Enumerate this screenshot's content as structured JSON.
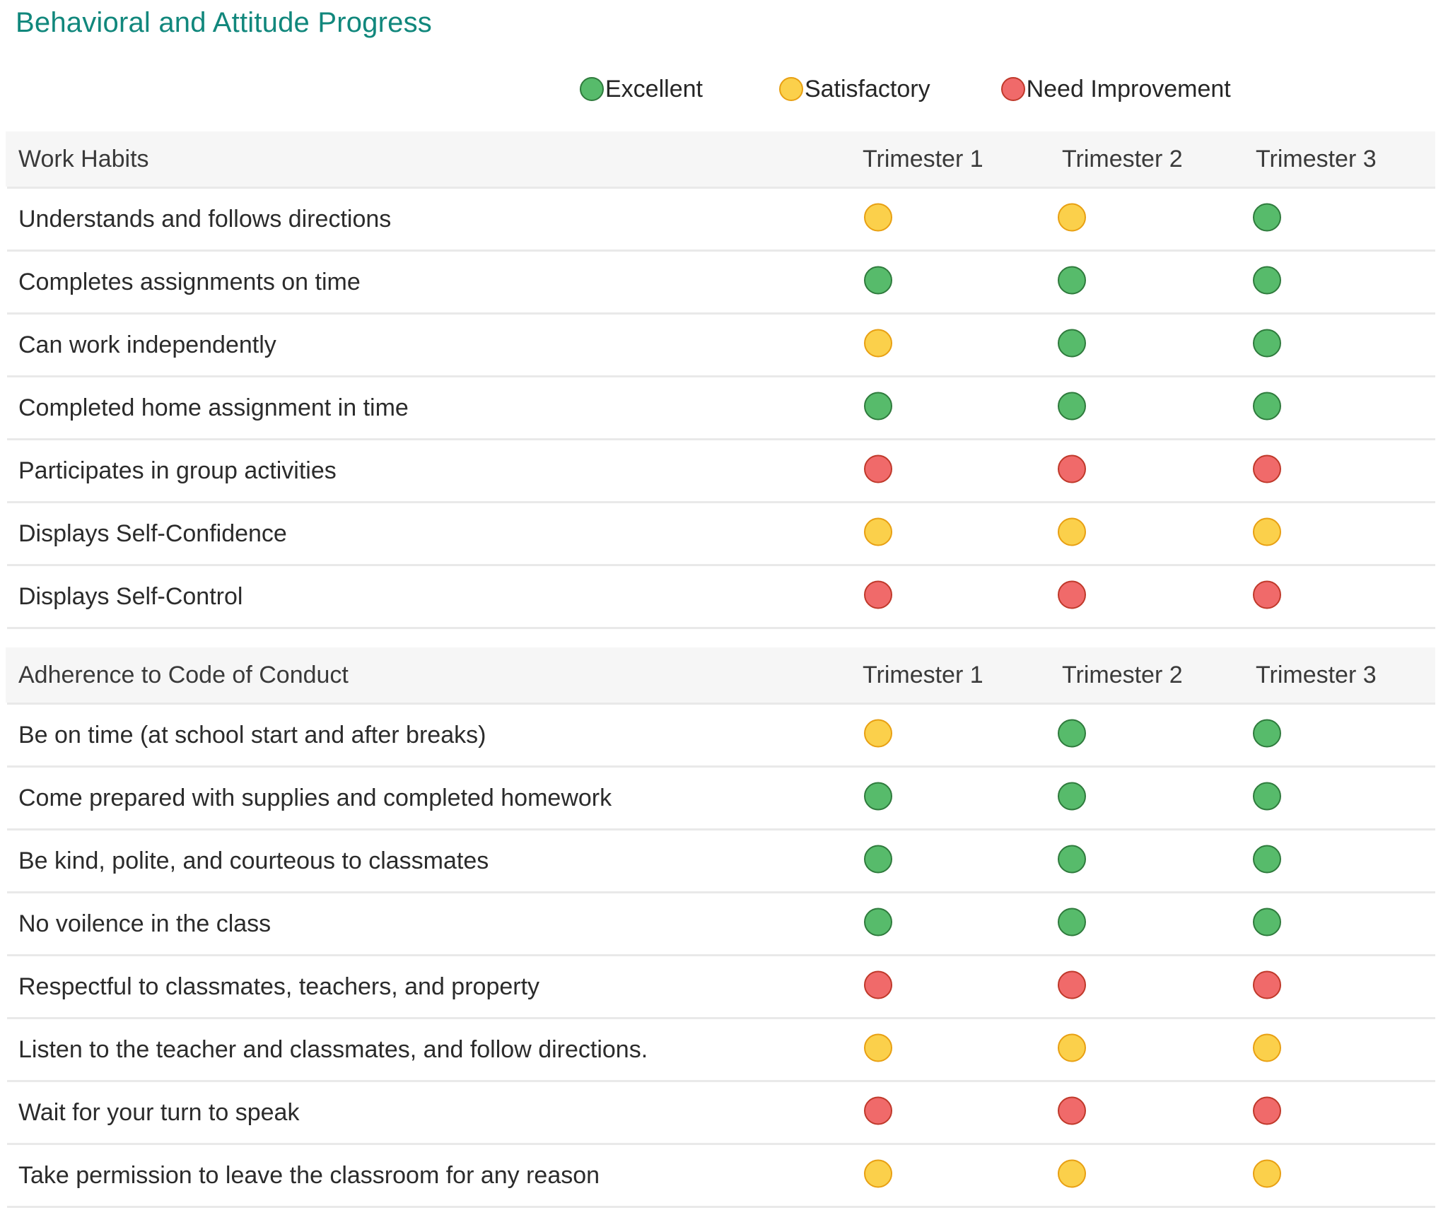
{
  "title": "Behavioral and Attitude Progress",
  "legend": {
    "items": [
      {
        "label": "Excellent",
        "status": "excellent",
        "color": "#57bb6b",
        "icon": "circle-icon"
      },
      {
        "label": "Satisfactory",
        "status": "satisfactory",
        "color": "#fbd04b",
        "icon": "circle-icon"
      },
      {
        "label": "Need Improvement",
        "status": "need-improvement",
        "color": "#f06a6a",
        "icon": "circle-icon"
      }
    ]
  },
  "columns": [
    "Trimester 1",
    "Trimester 2",
    "Trimester 3"
  ],
  "sections": [
    {
      "title": "Work Habits",
      "columns": [
        "Trimester 1",
        "Trimester 2",
        "Trimester 3"
      ],
      "rows": [
        {
          "label": "Understands and follows directions",
          "values": [
            "satisfactory",
            "satisfactory",
            "excellent"
          ]
        },
        {
          "label": "Completes assignments on time",
          "values": [
            "excellent",
            "excellent",
            "excellent"
          ]
        },
        {
          "label": "Can work independently",
          "values": [
            "satisfactory",
            "excellent",
            "excellent"
          ]
        },
        {
          "label": "Completed home assignment in time",
          "values": [
            "excellent",
            "excellent",
            "excellent"
          ]
        },
        {
          "label": "Participates in group activities",
          "values": [
            "need-improvement",
            "need-improvement",
            "need-improvement"
          ]
        },
        {
          "label": "Displays Self-Confidence",
          "values": [
            "satisfactory",
            "satisfactory",
            "satisfactory"
          ]
        },
        {
          "label": "Displays Self-Control",
          "values": [
            "need-improvement",
            "need-improvement",
            "need-improvement"
          ]
        }
      ]
    },
    {
      "title": "Adherence to Code of Conduct",
      "columns": [
        "Trimester 1",
        "Trimester 2",
        "Trimester 3"
      ],
      "rows": [
        {
          "label": "Be on time (at school start and after breaks)",
          "values": [
            "satisfactory",
            "excellent",
            "excellent"
          ]
        },
        {
          "label": "Come prepared with supplies and completed homework",
          "values": [
            "excellent",
            "excellent",
            "excellent"
          ]
        },
        {
          "label": "Be kind, polite, and courteous to classmates",
          "values": [
            "excellent",
            "excellent",
            "excellent"
          ]
        },
        {
          "label": "No voilence in the class",
          "values": [
            "excellent",
            "excellent",
            "excellent"
          ]
        },
        {
          "label": "Respectful to classmates, teachers, and property",
          "values": [
            "need-improvement",
            "need-improvement",
            "need-improvement"
          ]
        },
        {
          "label": "Listen to the teacher and classmates, and follow directions.",
          "values": [
            "satisfactory",
            "satisfactory",
            "satisfactory"
          ]
        },
        {
          "label": "Wait for your turn to speak",
          "values": [
            "need-improvement",
            "need-improvement",
            "need-improvement"
          ]
        },
        {
          "label": "Take permission to leave the classroom for any reason",
          "values": [
            "satisfactory",
            "satisfactory",
            "satisfactory"
          ]
        }
      ]
    }
  ],
  "colors": {
    "title": "#11877c",
    "excellent": "#57bb6b",
    "satisfactory": "#fbd04b",
    "need_improvement": "#f06a6a",
    "header_background": "#f6f6f6",
    "divider": "#e9e9e9"
  }
}
